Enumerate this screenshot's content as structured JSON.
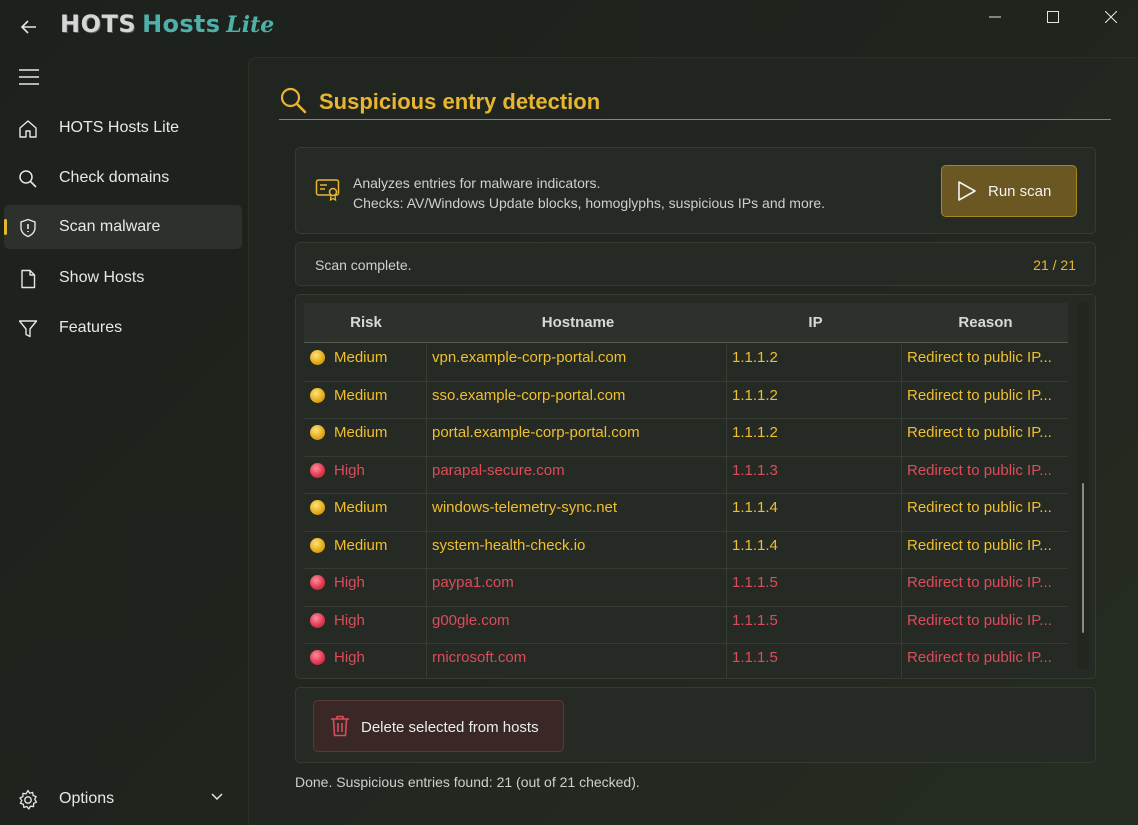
{
  "app": {
    "logo_part1": "HOTS",
    "logo_part2": "Hosts",
    "logo_part3": "Lite"
  },
  "window_controls": {
    "minimize": "minimize-icon",
    "maximize": "maximize-icon",
    "close": "close-icon"
  },
  "sidebar": {
    "items": [
      {
        "label": "HOTS Hosts Lite",
        "icon": "home-icon"
      },
      {
        "label": "Check domains",
        "icon": "search-icon"
      },
      {
        "label": "Scan malware",
        "icon": "shield-icon",
        "active": true
      },
      {
        "label": "Show Hosts",
        "icon": "document-icon"
      },
      {
        "label": "Features",
        "icon": "filter-icon"
      }
    ],
    "options_label": "Options"
  },
  "page": {
    "title": "Suspicious entry detection"
  },
  "info": {
    "line1": "Analyzes entries for malware indicators.",
    "line2": "Checks: AV/Windows Update blocks, homoglyphs, suspicious IPs and more.",
    "run_label": "Run scan"
  },
  "status": {
    "text": "Scan complete.",
    "count": "21 / 21"
  },
  "table": {
    "headers": [
      "Risk",
      "Hostname",
      "IP",
      "Reason"
    ],
    "rows": [
      {
        "risk": "Medium",
        "hostname": "vpn.example-corp-portal.com",
        "ip": "1.1.1.2",
        "reason": "Redirect to public IP..."
      },
      {
        "risk": "Medium",
        "hostname": "sso.example-corp-portal.com",
        "ip": "1.1.1.2",
        "reason": "Redirect to public IP..."
      },
      {
        "risk": "Medium",
        "hostname": "portal.example-corp-portal.com",
        "ip": "1.1.1.2",
        "reason": "Redirect to public IP..."
      },
      {
        "risk": "High",
        "hostname": "parapal-secure.com",
        "ip": "1.1.1.3",
        "reason": "Redirect to public IP..."
      },
      {
        "risk": "Medium",
        "hostname": "windows-telemetry-sync.net",
        "ip": "1.1.1.4",
        "reason": "Redirect to public IP..."
      },
      {
        "risk": "Medium",
        "hostname": "system-health-check.io",
        "ip": "1.1.1.4",
        "reason": "Redirect to public IP..."
      },
      {
        "risk": "High",
        "hostname": "paypa1.com",
        "ip": "1.1.1.5",
        "reason": "Redirect to public IP..."
      },
      {
        "risk": "High",
        "hostname": "g00gle.com",
        "ip": "1.1.1.5",
        "reason": "Redirect to public IP..."
      },
      {
        "risk": "High",
        "hostname": "rnicrosoft.com",
        "ip": "1.1.1.5",
        "reason": "Redirect to public IP..."
      }
    ]
  },
  "actions": {
    "delete_label": "Delete selected from hosts"
  },
  "footer": {
    "text": "Done. Suspicious entries found: 21 (out of 21 checked)."
  },
  "colors": {
    "accent": "#e8b531",
    "medium": "#efbf2e",
    "high": "#dc4c5a"
  }
}
